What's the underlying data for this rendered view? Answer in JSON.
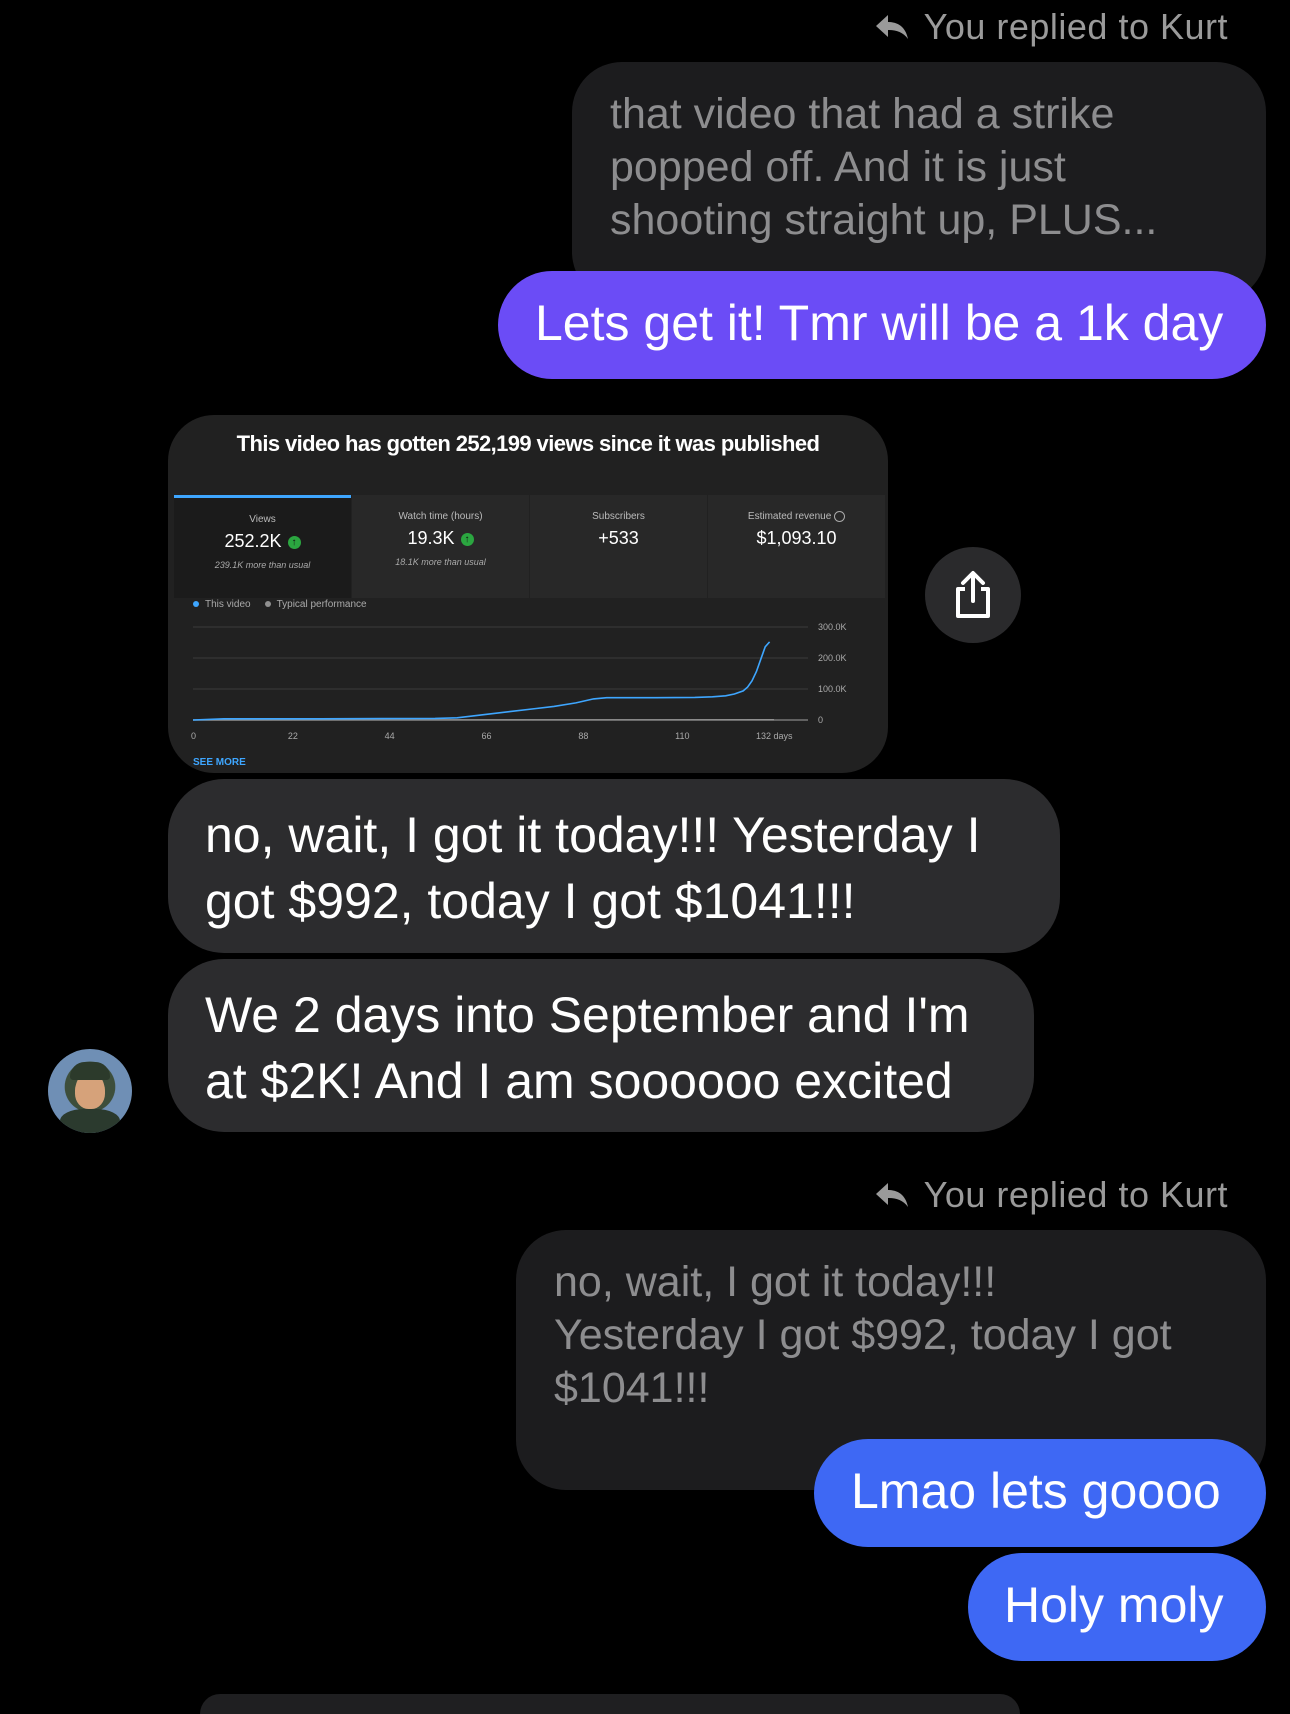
{
  "thread": {
    "reply_label_1": "You replied to Kurt",
    "quoted_1": [
      "that video that had a strike",
      "popped off.  And it is just",
      "shooting straight up, PLUS..."
    ],
    "message_1": "Lets get it! Tmr will be a 1k day",
    "screenshot": {
      "title": "This video has gotten 252,199 views since it was published",
      "tabs": [
        {
          "label": "Views",
          "value": "252.2K",
          "sub": "239.1K more than usual"
        },
        {
          "label": "Watch time (hours)",
          "value": "19.3K",
          "sub": "18.1K more than usual"
        },
        {
          "label": "Subscribers",
          "value": "+533",
          "sub": ""
        },
        {
          "label": "Estimated revenue",
          "value": "$1,093.10",
          "sub": ""
        }
      ],
      "legend": [
        "This video",
        "Typical performance"
      ],
      "see_more": "SEE MORE",
      "colors": {
        "this_video": "#3ea6ff",
        "typical": "#909090",
        "up_badge": "#2ba640"
      }
    },
    "incoming_1": "no, wait, I got it today!!!  Yesterday I got $992, today I got $1041!!!",
    "incoming_2": "We 2 days into September and I'm at $2K!  And I am soooooo excited",
    "reply_label_2": "You replied to Kurt",
    "quoted_2": [
      "no, wait, I got it today!!!",
      "Yesterday I got $992, today I got",
      "$1041!!!"
    ],
    "message_2": "Lmao lets goooo",
    "message_3": "Holy moly",
    "share_icon": "share-icon",
    "colors": {
      "purple_bubble": "#6b4cf6",
      "blue_bubble": "#3e68f4",
      "gray_bubble": "#2c2c2e"
    }
  },
  "chart_data": {
    "type": "line",
    "title": "",
    "xlabel": "",
    "ylabel": "",
    "x_ticks": [
      "0",
      "22",
      "44",
      "66",
      "88",
      "110",
      "132 days"
    ],
    "y_ticks": [
      "300.0K",
      "200.0K",
      "100.0K",
      "0"
    ],
    "ylim": [
      0,
      300000
    ],
    "xlim": [
      0,
      132
    ],
    "series": [
      {
        "name": "This video",
        "x": [
          0,
          7,
          15,
          29,
          55,
          60,
          66,
          72,
          78,
          82,
          87,
          91,
          94,
          105,
          114,
          118,
          121,
          123,
          125,
          126,
          127,
          128,
          129,
          130,
          131
        ],
        "y": [
          0,
          4000,
          4000,
          4000,
          5000,
          7000,
          17000,
          27000,
          37000,
          44000,
          55000,
          68000,
          72000,
          72000,
          73000,
          75000,
          78000,
          84000,
          94000,
          106000,
          126000,
          156000,
          196000,
          236000,
          252000
        ]
      },
      {
        "name": "Typical performance",
        "x": [
          0,
          132
        ],
        "y": [
          0,
          1000
        ]
      }
    ],
    "grid": true
  }
}
